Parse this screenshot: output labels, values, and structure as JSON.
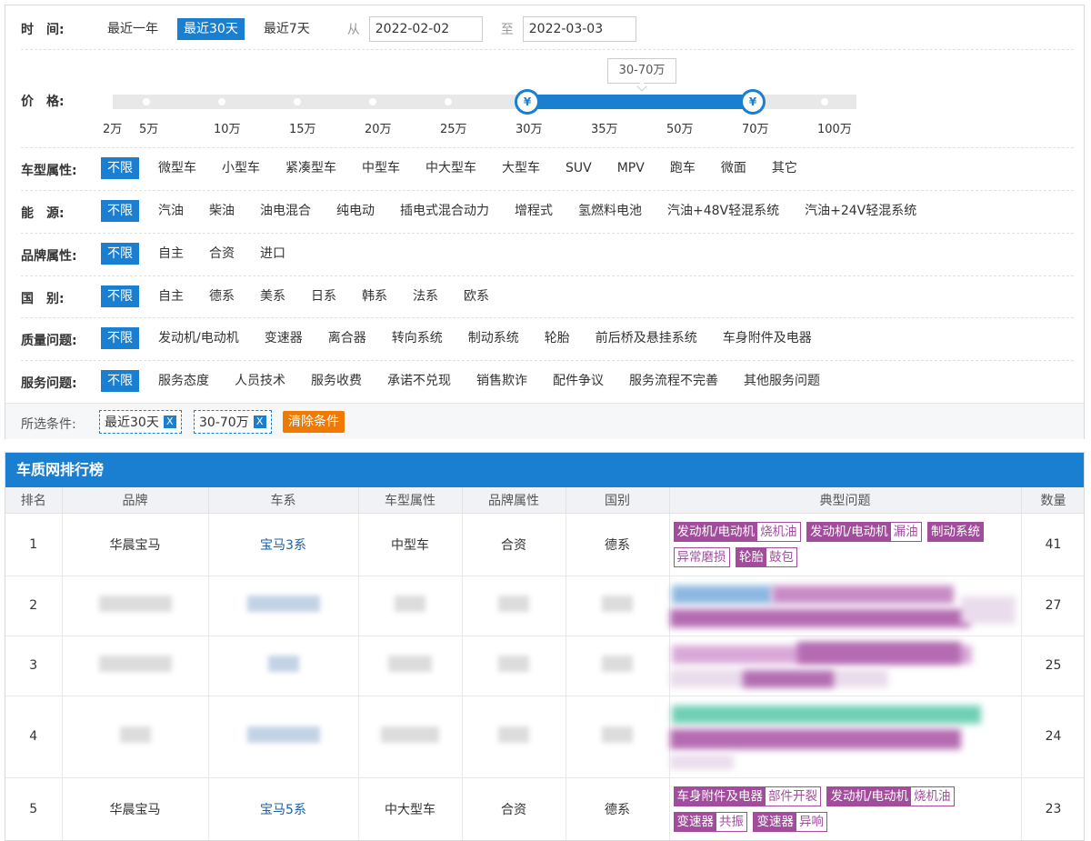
{
  "filters": {
    "time": {
      "label": "时　间:",
      "options": [
        "最近一年",
        "最近30天",
        "最近7天"
      ],
      "active_index": 1,
      "from_label": "从",
      "from_value": "2022-02-02",
      "to_label": "至",
      "to_value": "2022-03-03"
    },
    "price": {
      "label": "价　格:",
      "tooltip": "30-70万",
      "ticks": [
        "2万",
        "5万",
        "10万",
        "15万",
        "20万",
        "25万",
        "30万",
        "35万",
        "50万",
        "70万",
        "100万"
      ],
      "handle_symbol": "¥",
      "range_low": "30万",
      "range_high": "70万"
    },
    "car_type": {
      "label": "车型属性:",
      "options": [
        "不限",
        "微型车",
        "小型车",
        "紧凑型车",
        "中型车",
        "中大型车",
        "大型车",
        "SUV",
        "MPV",
        "跑车",
        "微面",
        "其它"
      ]
    },
    "energy": {
      "label": "能　源:",
      "options": [
        "不限",
        "汽油",
        "柴油",
        "油电混合",
        "纯电动",
        "插电式混合动力",
        "增程式",
        "氢燃料电池",
        "汽油+48V轻混系统",
        "汽油+24V轻混系统"
      ]
    },
    "brand_attr": {
      "label": "品牌属性:",
      "options": [
        "不限",
        "自主",
        "合资",
        "进口"
      ]
    },
    "country": {
      "label": "国　别:",
      "options": [
        "不限",
        "自主",
        "德系",
        "美系",
        "日系",
        "韩系",
        "法系",
        "欧系"
      ]
    },
    "quality": {
      "label": "质量问题:",
      "options": [
        "不限",
        "发动机/电动机",
        "变速器",
        "离合器",
        "转向系统",
        "制动系统",
        "轮胎",
        "前后桥及悬挂系统",
        "车身附件及电器"
      ]
    },
    "service": {
      "label": "服务问题:",
      "options": [
        "不限",
        "服务态度",
        "人员技术",
        "服务收费",
        "承诺不兑现",
        "销售欺诈",
        "配件争议",
        "服务流程不完善",
        "其他服务问题"
      ]
    }
  },
  "selected": {
    "label": "所选条件:",
    "chips": [
      "最近30天",
      "30-70万"
    ],
    "chip_close": "X",
    "clear_label": "清除条件"
  },
  "ranking": {
    "title": "车质网排行榜",
    "columns": [
      "排名",
      "品牌",
      "车系",
      "车型属性",
      "品牌属性",
      "国别",
      "典型问题",
      "数量"
    ],
    "rows": [
      {
        "rank": "1",
        "brand": "华晨宝马",
        "series": "宝马3系",
        "type": "中型车",
        "brand_attr": "合资",
        "country": "德系",
        "issues": [
          {
            "k": "发动机/电动机",
            "v": "烧机油"
          },
          {
            "k": "发动机/电动机",
            "v": "漏油"
          },
          {
            "k": "制动系统",
            "v": "异常磨损"
          },
          {
            "k": "轮胎",
            "v": "鼓包"
          }
        ],
        "count": "41"
      },
      {
        "rank": "2",
        "count": "27"
      },
      {
        "rank": "3",
        "count": "25"
      },
      {
        "rank": "4",
        "count": "24"
      },
      {
        "rank": "5",
        "brand": "华晨宝马",
        "series": "宝马5系",
        "type": "中大型车",
        "brand_attr": "合资",
        "country": "德系",
        "issues": [
          {
            "k": "车身附件及电器",
            "v": "部件开裂"
          },
          {
            "k": "发动机/电动机",
            "v": "烧机油"
          },
          {
            "k": "变速器",
            "v": "共振"
          },
          {
            "k": "变速器",
            "v": "异响"
          }
        ],
        "count": "23"
      }
    ]
  },
  "colors": {
    "accent": "#1a7fd0",
    "issue_tag": "#a24d9c",
    "clear_button": "#f07a00"
  }
}
